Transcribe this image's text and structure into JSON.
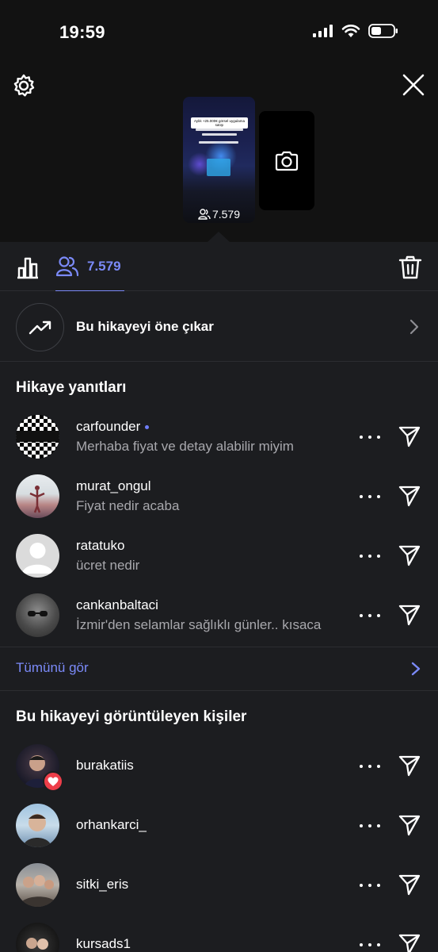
{
  "status_bar": {
    "time": "19:59"
  },
  "story_preview": {
    "view_count": "7.579",
    "caption_text": "Aylık +25.000€ görsel uygulama satışı"
  },
  "tabs": {
    "viewers_count": "7.579"
  },
  "promote": {
    "label": "Bu hikayeyi öne çıkar"
  },
  "replies": {
    "title": "Hikaye yanıtları",
    "items": [
      {
        "username": "carfounder",
        "message": "Merhaba fiyat ve detay alabilir miyim",
        "unread": true
      },
      {
        "username": "murat_ongul",
        "message": "Fiyat nedir acaba",
        "unread": false
      },
      {
        "username": "ratatuko",
        "message": "ücret nedir",
        "unread": false
      },
      {
        "username": "cankanbaltaci",
        "message": "İzmir'den selamlar sağlıklı günler.. kısaca",
        "unread": false
      }
    ],
    "see_all": "Tümünü gör"
  },
  "viewers": {
    "title": "Bu hikayeyi görüntüleyen kişiler",
    "items": [
      {
        "username": "burakatiis",
        "liked": true
      },
      {
        "username": "orhankarci_",
        "liked": false
      },
      {
        "username": "sitki_eris",
        "liked": false
      },
      {
        "username": "kursads1",
        "liked": false
      }
    ]
  },
  "colors": {
    "accent": "#7b8af8",
    "background": "#1c1d20",
    "header_bg": "#121212",
    "like": "#ed3e4a"
  }
}
